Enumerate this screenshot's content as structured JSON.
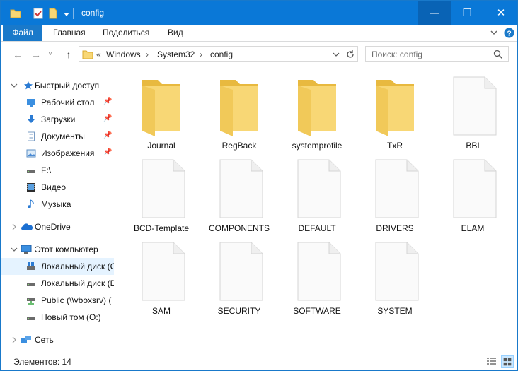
{
  "window": {
    "title": "config"
  },
  "titlebar": {
    "min_glyph": "—",
    "max_glyph": "☐",
    "close_glyph": "✕"
  },
  "ribbon": {
    "tabs": [
      {
        "label": "Файл"
      },
      {
        "label": "Главная"
      },
      {
        "label": "Поделиться"
      },
      {
        "label": "Вид"
      }
    ]
  },
  "address": {
    "prefix": "«",
    "crumbs": [
      "Windows",
      "System32",
      "config"
    ],
    "separator": "›"
  },
  "search": {
    "placeholder": "Поиск: config"
  },
  "sidebar": {
    "quick_access": "Быстрый доступ",
    "items": [
      {
        "label": "Рабочий стол",
        "icon": "desktop-icon",
        "pinned": true
      },
      {
        "label": "Загрузки",
        "icon": "downloads-icon",
        "pinned": true
      },
      {
        "label": "Документы",
        "icon": "documents-icon",
        "pinned": true
      },
      {
        "label": "Изображения",
        "icon": "pictures-icon",
        "pinned": true
      },
      {
        "label": "F:\\",
        "icon": "drive-icon",
        "pinned": false
      },
      {
        "label": "Видео",
        "icon": "videos-icon",
        "pinned": false
      },
      {
        "label": "Музыка",
        "icon": "music-icon",
        "pinned": false
      }
    ],
    "onedrive": "OneDrive",
    "this_pc": "Этот компьютер",
    "drives": [
      {
        "label": "Локальный диск (C",
        "selected": true
      },
      {
        "label": "Локальный диск (D",
        "selected": false
      },
      {
        "label": "Public (\\\\vboxsrv) (",
        "selected": false
      },
      {
        "label": "Новый том (O:)",
        "selected": false
      }
    ],
    "network": "Сеть"
  },
  "files": [
    {
      "name": "Journal",
      "type": "folder"
    },
    {
      "name": "RegBack",
      "type": "folder"
    },
    {
      "name": "systemprofile",
      "type": "folder"
    },
    {
      "name": "TxR",
      "type": "folder"
    },
    {
      "name": "BBI",
      "type": "file"
    },
    {
      "name": "BCD-Template",
      "type": "file"
    },
    {
      "name": "COMPONENTS",
      "type": "file"
    },
    {
      "name": "DEFAULT",
      "type": "file"
    },
    {
      "name": "DRIVERS",
      "type": "file"
    },
    {
      "name": "ELAM",
      "type": "file"
    },
    {
      "name": "SAM",
      "type": "file"
    },
    {
      "name": "SECURITY",
      "type": "file"
    },
    {
      "name": "SOFTWARE",
      "type": "file"
    },
    {
      "name": "SYSTEM",
      "type": "file"
    }
  ],
  "status": {
    "items_count": "Элементов: 14"
  },
  "colors": {
    "titlebar": "#0a78d7",
    "file_tab": "#1979ca",
    "selection": "#e5f3ff",
    "folder": "#f8d775"
  }
}
